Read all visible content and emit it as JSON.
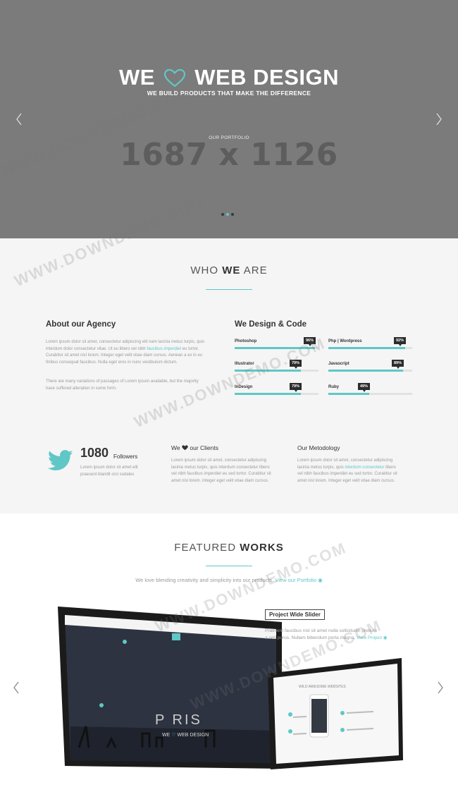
{
  "hero": {
    "title_left": "WE",
    "title_right": "WEB DESIGN",
    "subtitle": "WE BUILD PRODUCTS THAT MAKE THE DIFFERENCE",
    "label": "OUR PORTFOLIO",
    "placeholder_dimensions": "1687 x 1126",
    "slide_count": 3,
    "active_slide": 2,
    "bg_color": "#7b7b7b"
  },
  "about": {
    "title_light": "WHO",
    "title_bold": "WE",
    "title_light2": "ARE",
    "agency_title": "About our Agency",
    "agency_p1_a": "Lorem ipsum dolor sit amet, consectetur adipiscing elit nam lacinia metus turpis, quis",
    "agency_p1_b": "interdum dolor consectetur vitae. Ut eu libero vel nibh",
    "agency_p1_hl": "faucibus imperdiet",
    "agency_p1_c": "eu tortor.",
    "agency_p1_d": "Curabitur sit amet nisl lorem. Integer eget velit vitae diam cursus. Aenean a ex in eu",
    "agency_p1_e": "finibus consequat faucibus. Nulla eget eros in nunc vestibulum dictum.",
    "agency_p2_a": "There are many variations of passages of Lorem Ipsum available, but the majority",
    "agency_p2_b": "have suffered alteration in some form.",
    "skills_title": "We Design & Code",
    "skills": [
      {
        "name": "Photoshop",
        "percent": 96,
        "label": "96%"
      },
      {
        "name": "Php | Wordpress",
        "percent": 92,
        "label": "92%"
      },
      {
        "name": "Illustrator",
        "percent": 79,
        "label": "79%"
      },
      {
        "name": "Javascript",
        "percent": 89,
        "label": "89%"
      },
      {
        "name": "InDesign",
        "percent": 79,
        "label": "79%"
      },
      {
        "name": "Ruby",
        "percent": 49,
        "label": "49%"
      }
    ],
    "followers_count": "1080",
    "followers_label": "Followers",
    "followers_text_a": "Lorem ipsum dolor sit amet elit",
    "followers_text_b": "praesent blandit orci sodales",
    "clients_title_a": "We",
    "clients_title_b": "our Clients",
    "clients_text": [
      "Lorem ipsum dolor sit amet, consectetur adipiscing",
      "lacinia metus turpis, quis interdum consectetur libero",
      "vel nibh faucibus imperdiet eu sed tortor. Curabitur sit",
      "amet nisl lorem. Integer eget velit vitae diam cursus."
    ],
    "metodology_title": "Our Metodology",
    "metodology_text_a": "Lorem ipsum dolor sit amet, consectetur adipiscing",
    "metodology_text_b": "lacinia metus turpis, quis",
    "metodology_text_hl": "interdum consectetur",
    "metodology_text_c": "libero",
    "metodology_text_d": "vel nibh faucibus imperdiet eu sed tortor. Curabitur sit",
    "metodology_text_e": "amet nisl lorem. Integer eget velit vitae diam cursus."
  },
  "works": {
    "title_light": "FEATURED",
    "title_bold": "WORKS",
    "subtitle": "We love blending creativity and simplicity into our products.",
    "subtitle_link": "View our Portfolio",
    "project_title": "Project Wide Slider",
    "project_text_a": "Praesent faucibus nisl sit amet nulla sollicitudin pretium",
    "project_text_b": "a sed purus. Nullam bibendum porta magna.",
    "project_link": "View Project",
    "screen_logo": "P RIS",
    "screen_tagline": "WE",
    "screen_tagline_b": "WEB DESIGN",
    "device_heading": "WILD AWESOME WEBSITES"
  },
  "watermark": "WWW.DOWNDEMO.COM",
  "colors": {
    "accent": "#5fc7c6",
    "dark": "#2c2c2c",
    "hero_bg": "#7b7b7b"
  }
}
